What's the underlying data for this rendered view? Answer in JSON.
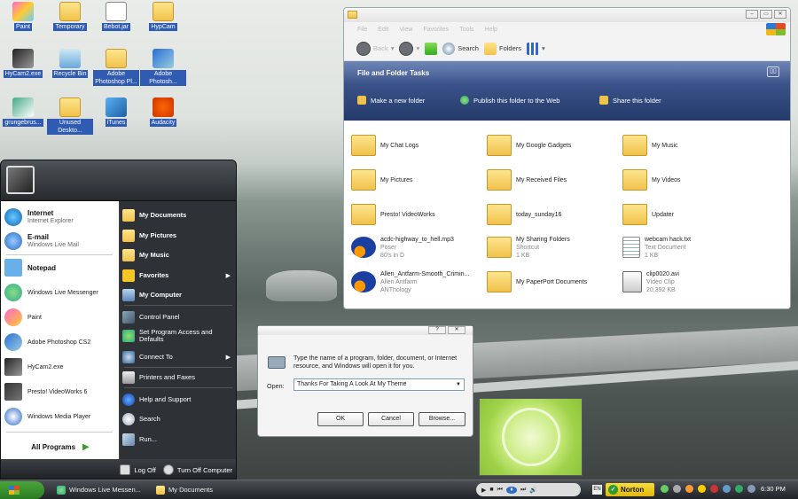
{
  "desktop": {
    "icons": [
      {
        "label": "Paint",
        "icon": "paint-icon"
      },
      {
        "label": "Temporary",
        "icon": "folder-icon"
      },
      {
        "label": "Bebot.jar",
        "icon": "jar-file-icon"
      },
      {
        "label": "HypCam",
        "icon": "folder-icon"
      },
      {
        "label": "HyCam2.exe",
        "icon": "hycam-icon"
      },
      {
        "label": "Recycle Bin",
        "icon": "recycle-bin-icon"
      },
      {
        "label": "Adobe Photoshop Pl...",
        "icon": "folder-icon"
      },
      {
        "label": "Adobe Photosh...",
        "icon": "photoshop-icon"
      },
      {
        "label": "grungebrus...",
        "icon": "brush-icon"
      },
      {
        "label": "Unused Deskto...",
        "icon": "folder-icon"
      },
      {
        "label": "iTunes",
        "icon": "itunes-icon"
      },
      {
        "label": "Audacity",
        "icon": "audacity-icon"
      }
    ]
  },
  "start_menu": {
    "pinned": [
      {
        "title": "Internet",
        "sub": "Internet Explorer"
      },
      {
        "title": "E-mail",
        "sub": "Windows Live Mail"
      }
    ],
    "recent": [
      "Notepad",
      "Windows Live Messenger",
      "Paint",
      "Adobe Photoshop CS2",
      "HyCam2.exe",
      "Presto! VideoWorks 6",
      "Windows Media Player"
    ],
    "all_programs": "All Programs",
    "right": [
      {
        "label": "My Documents",
        "bold": true
      },
      {
        "label": "My Pictures",
        "bold": true
      },
      {
        "label": "My Music",
        "bold": true
      },
      {
        "label": "Favorites",
        "bold": true,
        "arrow": "▶"
      },
      {
        "label": "My Computer",
        "bold": true
      },
      {
        "label": "Control Panel"
      },
      {
        "label": "Set Program Access and Defaults"
      },
      {
        "label": "Connect To",
        "arrow": "▶"
      },
      {
        "label": "Printers and Faxes"
      },
      {
        "label": "Help and Support"
      },
      {
        "label": "Search"
      },
      {
        "label": "Run..."
      }
    ],
    "log_off": "Log Off",
    "turn_off": "Turn Off Computer"
  },
  "explorer": {
    "menu": [
      "File",
      "Edit",
      "View",
      "Favorites",
      "Tools",
      "Help"
    ],
    "toolbar": {
      "back": "Back",
      "search": "Search",
      "folders": "Folders"
    },
    "tasks_header": "File and Folder Tasks",
    "tasks": [
      "Make a new folder",
      "Publish this folder to the Web",
      "Share this folder"
    ],
    "items": [
      {
        "name": "My Chat Logs",
        "icon": "folder"
      },
      {
        "name": "My Google Gadgets",
        "icon": "folder"
      },
      {
        "name": "My Music",
        "icon": "music-folder"
      },
      {
        "name": "My Pictures",
        "icon": "pictures-folder"
      },
      {
        "name": "My Received Files",
        "icon": "folder"
      },
      {
        "name": "My Videos",
        "icon": "video-folder"
      },
      {
        "name": "Presto! VideoWorks",
        "icon": "folder"
      },
      {
        "name": "today_sunday16",
        "icon": "folder"
      },
      {
        "name": "Updater",
        "icon": "folder"
      },
      {
        "name": "acdc-highway_to_hell.mp3",
        "line2": "Poser",
        "line3": "80's in D",
        "icon": "media"
      },
      {
        "name": "My Sharing Folders",
        "line2": "Shortcut",
        "line3": "1 KB",
        "icon": "shared-folder"
      },
      {
        "name": "webcam hack.txt",
        "line2": "Text Document",
        "line3": "1 KB",
        "icon": "text"
      },
      {
        "name": "Allen_Antfarm-Smooth_Crimin...",
        "line2": "Allen Antfarm",
        "line3": "ANThology",
        "icon": "media"
      },
      {
        "name": "My PaperPort Documents",
        "icon": "folder"
      },
      {
        "name": "clip0020.avi",
        "line2": "Video Clip",
        "line3": "20,392 KB",
        "icon": "avi"
      }
    ]
  },
  "run_dialog": {
    "help_btn": "?",
    "close_btn": "✕",
    "message": "Type the name of a program, folder, document, or Internet resource, and Windows will open it for you.",
    "open_label": "Open:",
    "open_value": "Thanks For Taking A Look At My Theme",
    "ok": "OK",
    "cancel": "Cancel",
    "browse": "Browse..."
  },
  "taskbar": {
    "tasks": [
      "Windows Live Messen...",
      "My Documents"
    ],
    "norton": "Norton",
    "clock": "6:30 PM",
    "lang": "EN"
  },
  "colors": {
    "accent": "#2f5bb3",
    "tasks_panel": "#3a5289",
    "start_green": "#3a9a2e"
  }
}
